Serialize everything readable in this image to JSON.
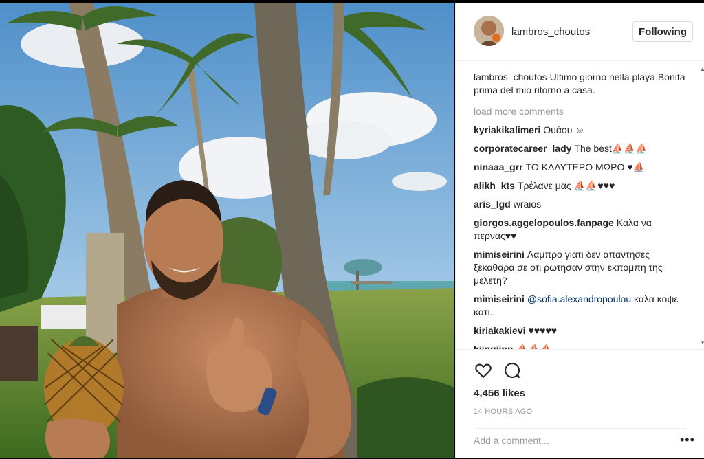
{
  "post": {
    "username": "lambros_choutos",
    "follow_label": "Following",
    "caption_user": "lambros_choutos",
    "caption_text": "Ultimo giorno nella playa Bonita prima del mio ritorno a casa.",
    "load_more": "load more comments",
    "comments": [
      {
        "user": "kyriakikalimeri",
        "text": "Ουάου ☺"
      },
      {
        "user": "corporatecareer_lady",
        "text": "The best⛵⛵⛵"
      },
      {
        "user": "ninaaa_grr",
        "text": "ΤΟ ΚΑΛΥΤΕΡΟ ΜΩΡΟ ♥⛵"
      },
      {
        "user": "alikh_kts",
        "text": "Τρέλανε μας ⛵⛵♥♥♥"
      },
      {
        "user": "aris_lgd",
        "text": "wraios"
      },
      {
        "user": "giorgos.aggelopoulos.fanpage",
        "text": "Καλα να περνας♥♥"
      },
      {
        "user": "mimiseirini",
        "text": "Λαμπρο γιατι δεν απαντησες ξεκαθαρα σε οτι ρωτησαν στην εκπομπη της μελετη?"
      },
      {
        "user": "mimiseirini",
        "mention": "@sofia.alexandropoulou",
        "text": " καλα κοψε κατι.."
      },
      {
        "user": "kiriakakievi",
        "text": "♥♥♥♥♥"
      },
      {
        "user": "kiingiinn",
        "text": "⛵⛵⛵"
      }
    ],
    "likes": "4,456 likes",
    "time": "14 HOURS AGO",
    "add_comment_placeholder": "Add a comment...",
    "more_icon": "•••"
  },
  "icons": {
    "like": "heart-icon",
    "comment": "comment-icon",
    "scroll_up": "▲",
    "scroll_down": "▼"
  },
  "colors": {
    "text": "#262626",
    "muted": "#999999",
    "border": "#efefef",
    "mention": "#003569"
  }
}
